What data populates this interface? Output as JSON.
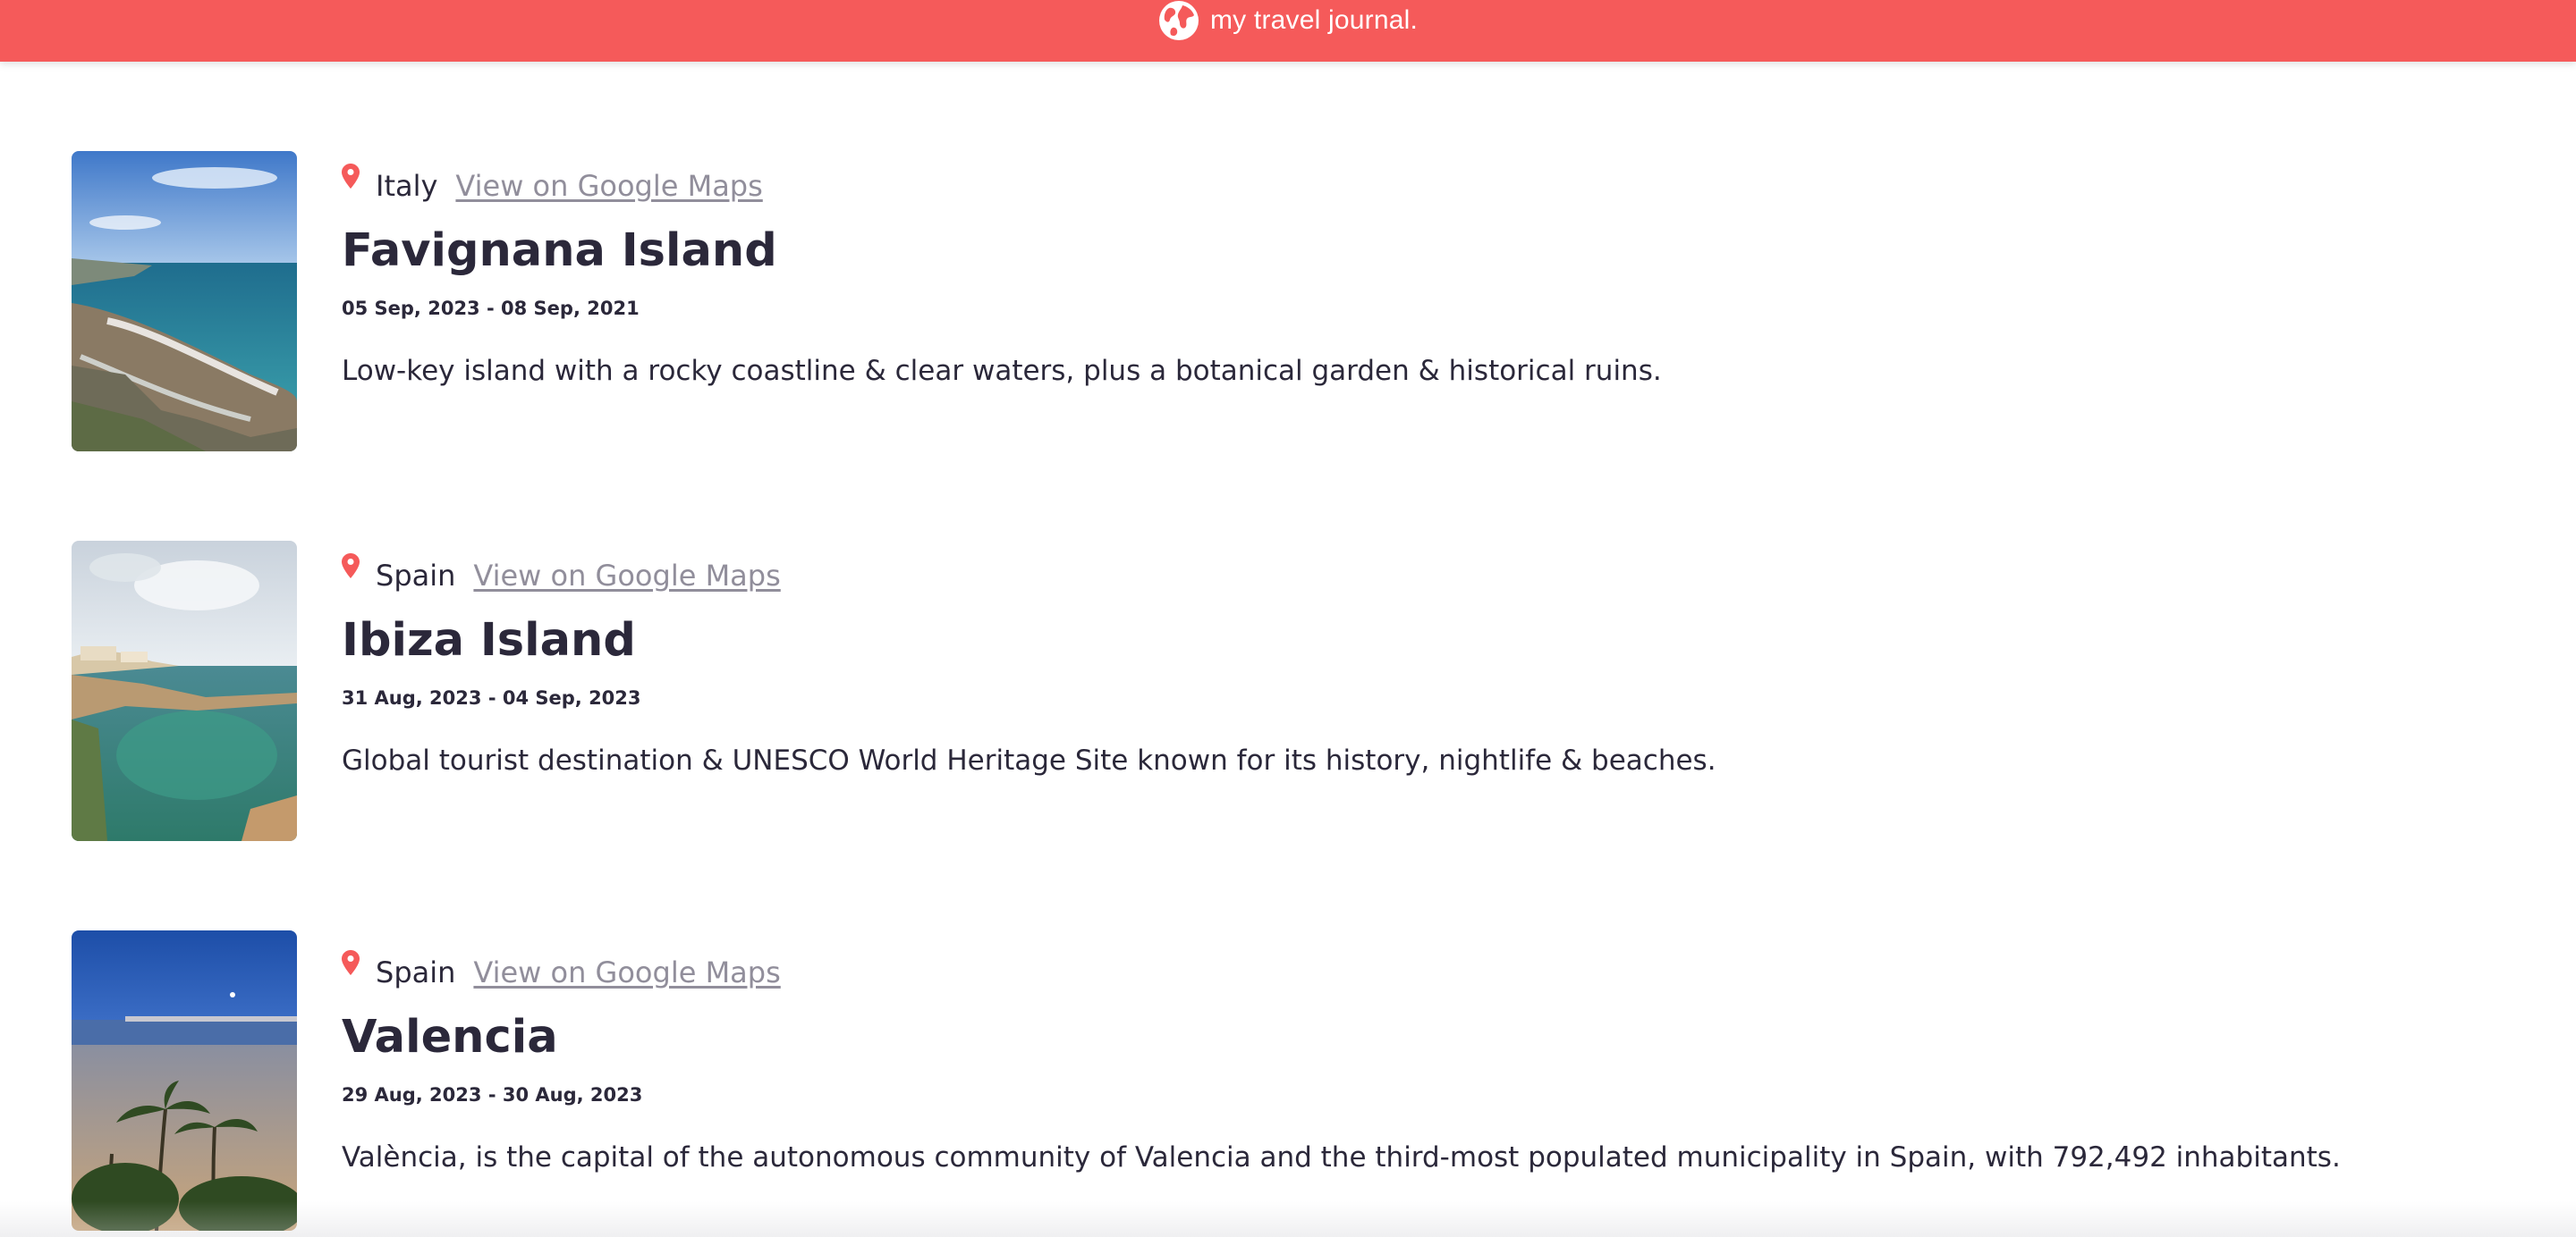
{
  "header": {
    "title": "my travel journal.",
    "icon": "globe-icon",
    "background": "#f55a5a"
  },
  "entries": [
    {
      "country": "Italy",
      "maps_link": "View on Google Maps",
      "title": "Favignana Island",
      "dates": "05 Sep, 2023 - 08 Sep, 2021",
      "description": "Low-key island with a rocky coastline & clear waters, plus a botanical garden & historical ruins.",
      "photo": "coastal-rocks-photo"
    },
    {
      "country": "Spain",
      "maps_link": "View on Google Maps",
      "title": "Ibiza Island",
      "dates": "31 Aug, 2023 - 04 Sep, 2023",
      "description": "Global tourist destination & UNESCO World Heritage Site known for its history, nightlife & beaches.",
      "photo": "cove-photo"
    },
    {
      "country": "Spain",
      "maps_link": "View on Google Maps",
      "title": "Valencia",
      "dates": "29 Aug, 2023 - 30 Aug, 2023",
      "description": "València, is the capital of the autonomous community of Valencia and the third-most populated municipality in Spain, with 792,492 inhabitants.",
      "photo": "beach-palms-photo"
    }
  ],
  "colors": {
    "accent": "#f55a5a",
    "text": "#2b283a",
    "link": "#918e9b"
  }
}
